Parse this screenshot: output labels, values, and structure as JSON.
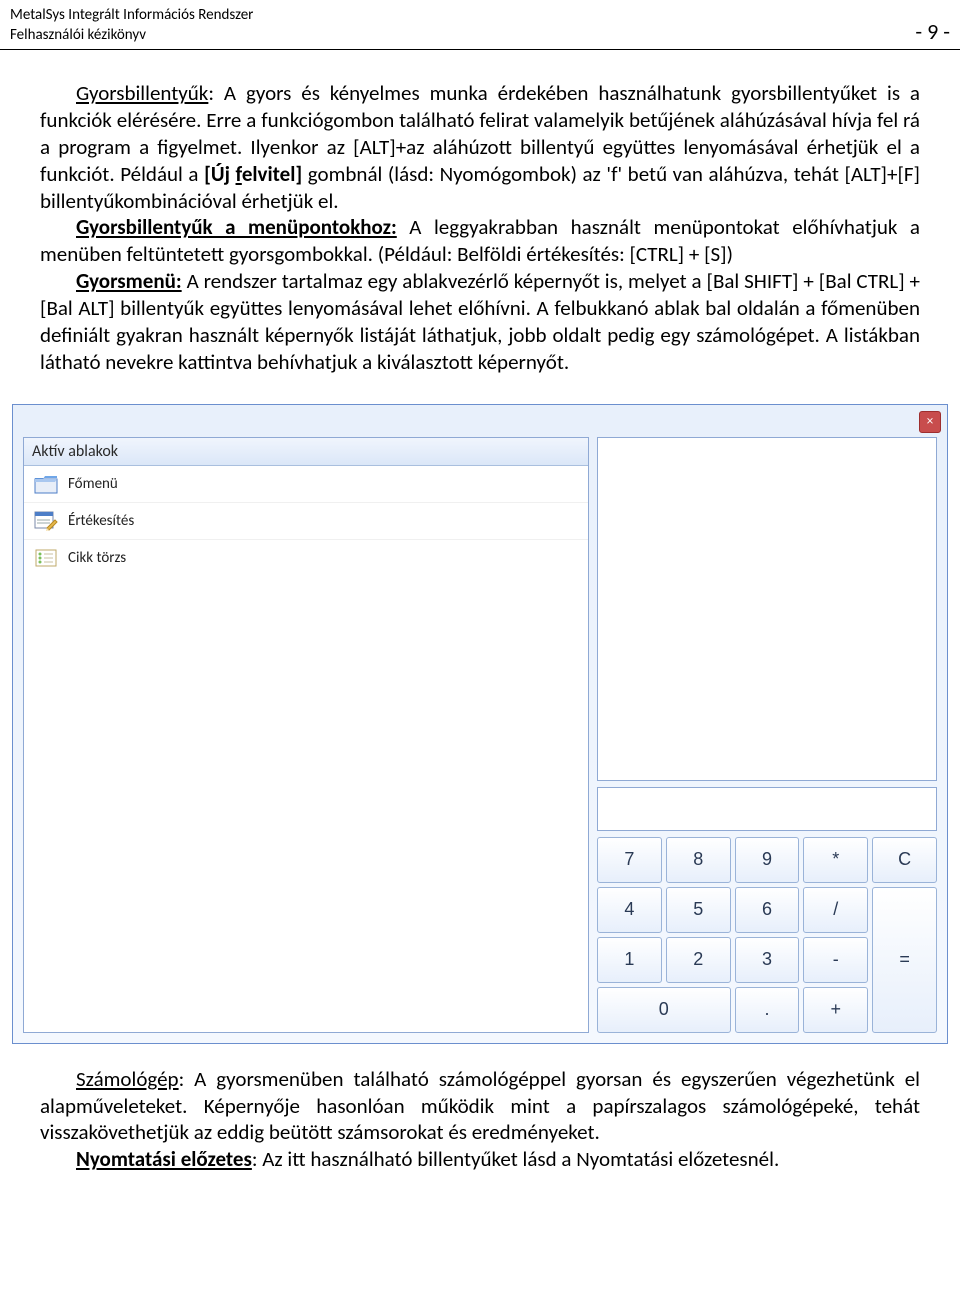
{
  "header": {
    "line1": "MetalSys Integrált Információs Rendszer",
    "line2": "Felhasználói kézikönyv",
    "page": "- 9 -"
  },
  "body": {
    "p1_label": "Gyorsbillentyűk",
    "p1_rest_a": ": A gyors és kényelmes munka érdekében használhatunk gyorsbillentyűket is a funkciók elérésére. Erre a funkciógombon található felirat valamelyik betűjének aláhúzásával hívja fel rá a program a figyelmet. Ilyenkor az [ALT]+az aláhúzott billentyű együttes lenyomásával érhetjük el a funkciót. Például a ",
    "p1_bold": "[Új felvitel]",
    "p1_rest_b": " gombnál (lásd: Nyomógombok) az 'f' betű van aláhúzva, tehát [ALT]+[F] billentyűkombinációval érhetjük el.",
    "p2_label": "Gyorsbillentyűk a menüpontokhoz:",
    "p2_rest": " A leggyakrabban használt menüpontokat előhívhatjuk a menüben feltüntetett gyorsgombokkal. (Például: Belföldi értékesítés: [CTRL] + [S])",
    "p3_label": "Gyorsmenü:",
    "p3_rest": " A rendszer tartalmaz egy ablakvezérlő képernyőt is, melyet a [Bal SHIFT] + [Bal CTRL] + [Bal ALT] billentyűk együttes lenyomásával lehet előhívni. A felbukkanó ablak bal oldalán a főmenüben definiált gyakran használt képernyők listáját láthatjuk, jobb oldalt pedig egy számológépet. A listákban látható nevekre kattintva behívhatjuk a kiválasztott képernyőt."
  },
  "window": {
    "close": "×",
    "panel_title": "Aktív ablakok",
    "items": [
      {
        "label": "Főmenü"
      },
      {
        "label": "Értékesítés"
      },
      {
        "label": "Cikk törzs"
      }
    ],
    "calc": {
      "input": "",
      "buttons": [
        [
          "7",
          "8",
          "9",
          "*",
          "C"
        ],
        [
          "4",
          "5",
          "6",
          "/"
        ],
        [
          "1",
          "2",
          "3",
          "-",
          "="
        ],
        [
          "0",
          ".",
          "+"
        ]
      ]
    }
  },
  "footer": {
    "p1_label": "Számológép",
    "p1_rest": ": A gyorsmenüben található számológéppel gyorsan és egyszerűen végezhetünk el alapműveleteket. Képernyője hasonlóan működik mint a papírszalagos számológépeké, tehát visszakövethetjük az eddig beütött számsorokat és eredményeket.",
    "p2_label": "Nyomtatási előzetes",
    "p2_rest": ": Az itt használható billentyűket lásd a Nyomtatási előzetesnél."
  }
}
